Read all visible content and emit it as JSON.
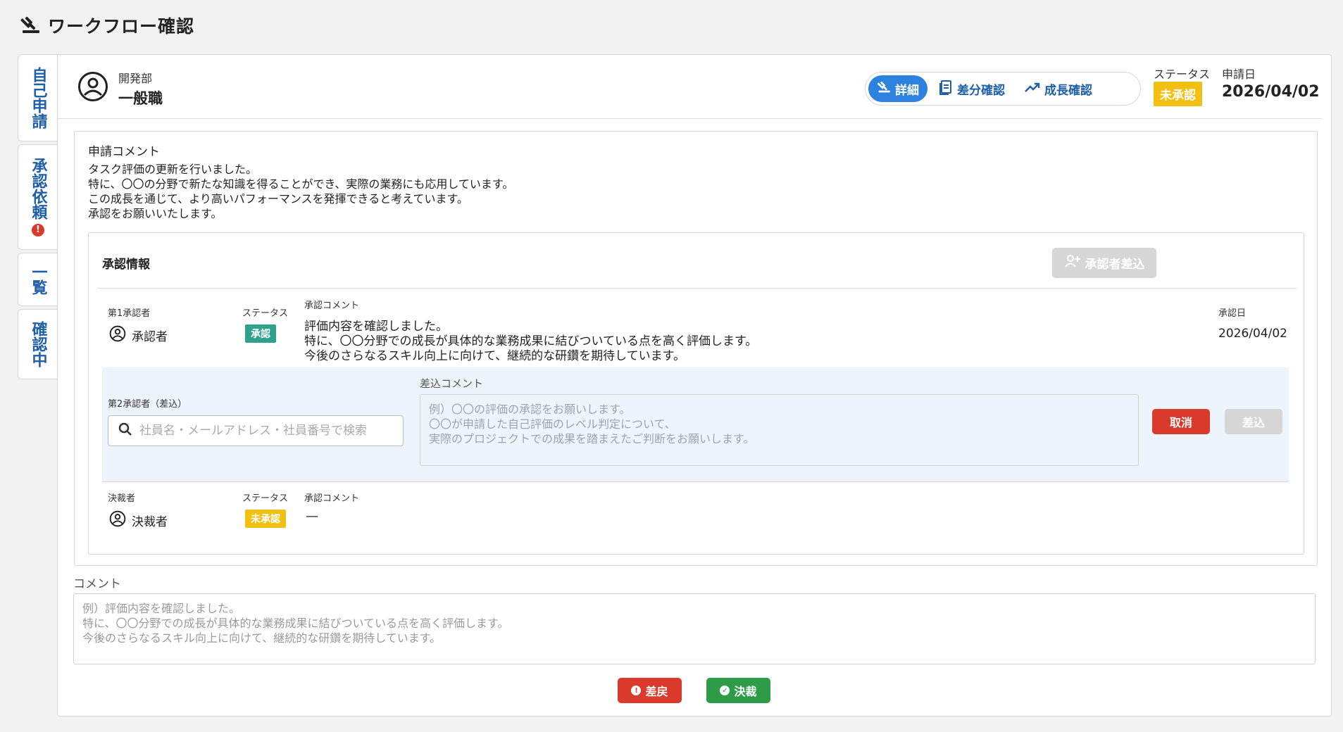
{
  "app": {
    "title": "ワークフロー確認",
    "logo_icon": "gavel-icon"
  },
  "side_tabs": [
    {
      "label": "自己申請",
      "has_alert": false
    },
    {
      "label": "承認依頼",
      "has_alert": true,
      "alert_text": "!"
    },
    {
      "label": "一覧",
      "has_alert": false
    },
    {
      "label": "確認中",
      "has_alert": false
    }
  ],
  "header": {
    "department": "開発部",
    "position": "一般職",
    "view_tabs": [
      {
        "label": "詳細",
        "icon": "gavel-icon",
        "active": true
      },
      {
        "label": "差分確認",
        "icon": "document-icon",
        "active": false
      },
      {
        "label": "成長確認",
        "icon": "trending-up-icon",
        "active": false
      }
    ],
    "status_label": "ステータス",
    "status_value": "未承認",
    "apply_date_label": "申請日",
    "apply_date": "2026/04/02"
  },
  "application_comment": {
    "title": "申請コメント",
    "body": "タスク評価の更新を行いました。\n特に、〇〇の分野で新たな知識を得ることができ、実際の業務にも応用しています。\nこの成長を通じて、より高いパフォーマンスを発揮できると考えています。\n承認をお願いいたします。"
  },
  "approval_info": {
    "title": "承認情報",
    "add_approver_label": "承認者差込",
    "row1": {
      "role_label": "第1承認者",
      "name": "承認者",
      "status_label": "ステータス",
      "status": "承認",
      "comment_label": "承認コメント",
      "comment": "評価内容を確認しました。\n特に、〇〇分野での成長が具体的な業務成果に結びついている点を高く評価します。\n今後のさらなるスキル向上に向けて、継続的な研鑽を期待しています。",
      "date_label": "承認日",
      "date": "2026/04/02"
    },
    "row2": {
      "role_label": "第2承認者（差込）",
      "search_placeholder": "社員名・メールアドレス・社員番号で検索",
      "comment_label": "差込コメント",
      "comment_placeholder": "例）〇〇の評価の承認をお願いします。\n〇〇が申請した自己評価のレベル判定について、\n実際のプロジェクトでの成果を踏まえたご判断をお願いします。",
      "cancel_label": "取消",
      "submit_label": "差込"
    },
    "row3": {
      "role_label": "決裁者",
      "name": "決裁者",
      "status_label": "ステータス",
      "status": "未承認",
      "comment_label": "承認コメント",
      "comment": "—"
    }
  },
  "comment": {
    "label": "コメント",
    "placeholder": "例）評価内容を確認しました。\n特に、〇〇分野での成長が具体的な業務成果に結びついている点を高く評価します。\n今後のさらなるスキル向上に向けて、継続的な研鑽を期待しています。"
  },
  "actions": {
    "return_label": "差戻",
    "decide_label": "決裁"
  },
  "colors": {
    "primary": "#2d82e0",
    "tab_text": "#1f5fa8",
    "danger": "#d93a2b",
    "success": "#2e9b46",
    "approved_badge": "#2ea18a",
    "pending_badge": "#f2c012"
  }
}
